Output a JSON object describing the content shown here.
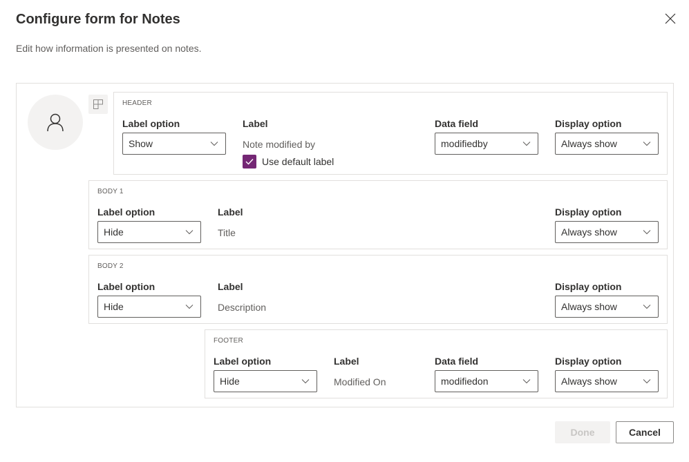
{
  "dialog": {
    "title": "Configure form for Notes",
    "subtitle": "Edit how information is presented on notes.",
    "close_icon": "close-icon"
  },
  "icons": {
    "avatar": "person-icon",
    "layout": "layout-grid-icon",
    "dropdown": "chevron-down-icon",
    "check": "checkmark-icon"
  },
  "colors": {
    "accent": "#742774",
    "border": "#e1dfdd",
    "disabled_bg": "#f3f2f1"
  },
  "columns": {
    "label_option": "Label option",
    "label": "Label",
    "data_field": "Data field",
    "display_option": "Display option"
  },
  "sections": {
    "header": {
      "title": "HEADER",
      "label_option": "Show",
      "label": "Note modified by",
      "use_default_label": "Use default label",
      "use_default_checked": true,
      "data_field": "modifiedby",
      "display_option": "Always show"
    },
    "body1": {
      "title": "BODY 1",
      "label_option": "Hide",
      "label": "Title",
      "display_option": "Always show"
    },
    "body2": {
      "title": "BODY 2",
      "label_option": "Hide",
      "label": "Description",
      "display_option": "Always show"
    },
    "footer": {
      "title": "FOOTER",
      "label_option": "Hide",
      "label": "Modified On",
      "data_field": "modifiedon",
      "display_option": "Always show"
    }
  },
  "footer_buttons": {
    "done": "Done",
    "cancel": "Cancel"
  }
}
